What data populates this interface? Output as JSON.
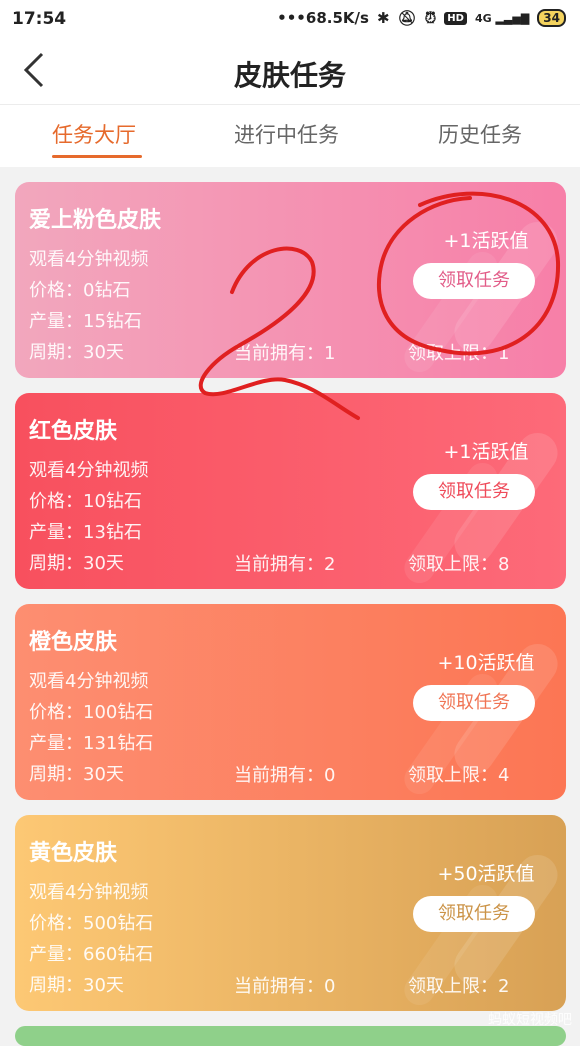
{
  "status_bar": {
    "time": "17:54",
    "network_speed": "•••68.5K/s",
    "signal": "4G",
    "battery": "34"
  },
  "header": {
    "title": "皮肤任务"
  },
  "tabs": [
    {
      "label": "任务大厅",
      "active": true
    },
    {
      "label": "进行中任务",
      "active": false
    },
    {
      "label": "历史任务",
      "active": false
    }
  ],
  "cards": [
    {
      "name": "爱上粉色皮肤",
      "watch": "观看4分钟视频",
      "price": "价格：0钻石",
      "output": "产量：15钻石",
      "cycle": "周期：30天",
      "owned": "当前拥有：1",
      "limit": "领取上限：1",
      "reward": "+1活跃值",
      "button": "领取任务"
    },
    {
      "name": "红色皮肤",
      "watch": "观看4分钟视频",
      "price": "价格：10钻石",
      "output": "产量：13钻石",
      "cycle": "周期：30天",
      "owned": "当前拥有：2",
      "limit": "领取上限：8",
      "reward": "+1活跃值",
      "button": "领取任务"
    },
    {
      "name": "橙色皮肤",
      "watch": "观看4分钟视频",
      "price": "价格：100钻石",
      "output": "产量：131钻石",
      "cycle": "周期：30天",
      "owned": "当前拥有：0",
      "limit": "领取上限：4",
      "reward": "+10活跃值",
      "button": "领取任务"
    },
    {
      "name": "黄色皮肤",
      "watch": "观看4分钟视频",
      "price": "价格：500钻石",
      "output": "产量：660钻石",
      "cycle": "周期：30天",
      "owned": "当前拥有：0",
      "limit": "领取上限：2",
      "reward": "+50活跃值",
      "button": "领取任务"
    }
  ],
  "watermark": "蚂蚁短视频吧",
  "colors": {
    "accent": "#e66a2c",
    "annotation": "#e02020"
  }
}
